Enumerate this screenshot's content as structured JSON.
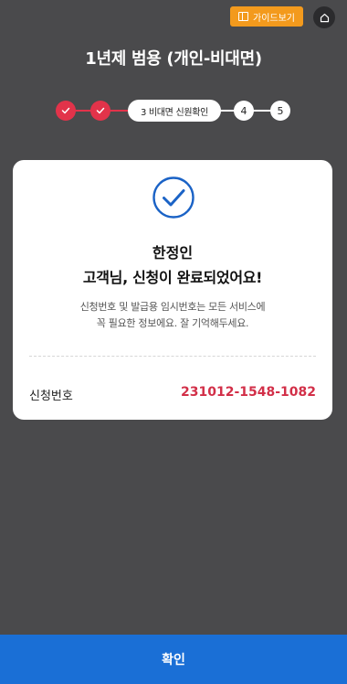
{
  "header": {
    "guide_label": "가이드보기",
    "guide_icon": "book-icon",
    "home_icon": "home-icon",
    "title": "1년제 범용 (개인-비대면)"
  },
  "stepper": {
    "completed_steps": [
      "1",
      "2"
    ],
    "current_step": "3 비대면 신원확인",
    "upcoming_steps": [
      "4",
      "5"
    ],
    "active_color": "#e2334a"
  },
  "result": {
    "name": "한정인",
    "message": "고객님, 신청이 완료되었어요!",
    "info_line1": "신청번호 및 발급용 임시번호는 모든 서비스에",
    "info_line2": "꼭 필요한 정보에요. 잘 기억해두세요.",
    "application_no_label": "신청번호",
    "application_no": "231012-1548-1082",
    "accent_color": "#d22f48"
  },
  "footer": {
    "confirm_label": "확인",
    "button_color": "#1a6fd6"
  }
}
